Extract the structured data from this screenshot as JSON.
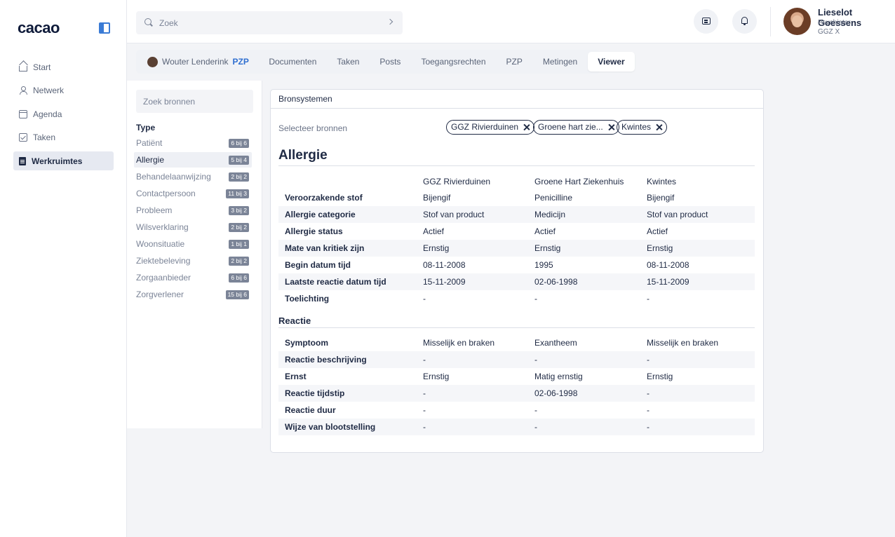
{
  "app": {
    "logo": "cacao"
  },
  "nav": [
    {
      "label": "Start",
      "icon": "home-icon",
      "active": false
    },
    {
      "label": "Netwerk",
      "icon": "user-icon",
      "active": false
    },
    {
      "label": "Agenda",
      "icon": "calendar-icon",
      "active": false
    },
    {
      "label": "Taken",
      "icon": "checkbox-icon",
      "active": false
    },
    {
      "label": "Werkruimtes",
      "icon": "document-icon",
      "active": true
    }
  ],
  "search": {
    "placeholder": "Zoek"
  },
  "user": {
    "name": "Lieselot Goessens",
    "role": "Psychiater",
    "org": "GGZ X"
  },
  "tabs": {
    "patient_name": "Wouter Lenderink",
    "patient_tag": "PZP",
    "items": [
      "Documenten",
      "Taken",
      "Posts",
      "Toegangsrechten",
      "PZP",
      "Metingen",
      "Viewer"
    ],
    "active": "Viewer"
  },
  "filter": {
    "search_placeholder": "Zoek bronnen",
    "type_heading": "Type",
    "types": [
      {
        "label": "Patiënt",
        "badge": "6 bij 6",
        "active": false
      },
      {
        "label": "Allergie",
        "badge": "5 bij 4",
        "active": true
      },
      {
        "label": "Behandelaanwijzing",
        "badge": "2 bij 2",
        "active": false
      },
      {
        "label": "Contactpersoon",
        "badge": "11 bij 3",
        "active": false
      },
      {
        "label": "Probleem",
        "badge": "3 bij 2",
        "active": false
      },
      {
        "label": "Wilsverklaring",
        "badge": "2 bij 2",
        "active": false
      },
      {
        "label": "Woonsituatie",
        "badge": "1 bij 1",
        "active": false
      },
      {
        "label": "Ziektebeleving",
        "badge": "2 bij 2",
        "active": false
      },
      {
        "label": "Zorgaanbieder",
        "badge": "6 bij 6",
        "active": false
      },
      {
        "label": "Zorgverlener",
        "badge": "15 bij 6",
        "active": false
      }
    ]
  },
  "viewer": {
    "card_title": "Bronsystemen",
    "select_label": "Selecteer bronnen",
    "chips": [
      "GGZ Rivierduinen",
      "Groene hart zie...",
      "Kwintes"
    ],
    "section_title": "Allergie",
    "columns": [
      "GGZ Rivierduinen",
      "Groene Hart Ziekenhuis",
      "Kwintes"
    ],
    "allergy_rows": [
      {
        "label": "Veroorzakende stof",
        "values": [
          "Bijengif",
          "Penicilline",
          "Bijengif"
        ]
      },
      {
        "label": "Allergie categorie",
        "values": [
          "Stof van product",
          "Medicijn",
          "Stof van product"
        ]
      },
      {
        "label": "Allergie status",
        "values": [
          "Actief",
          "Actief",
          "Actief"
        ]
      },
      {
        "label": "Mate van kritiek zijn",
        "values": [
          "Ernstig",
          "Ernstig",
          "Ernstig"
        ]
      },
      {
        "label": "Begin datum tijd",
        "values": [
          "08-11-2008",
          "1995",
          "08-11-2008"
        ]
      },
      {
        "label": "Laatste reactie datum tijd",
        "values": [
          "15-11-2009",
          "02-06-1998",
          "15-11-2009"
        ]
      },
      {
        "label": "Toelichting",
        "values": [
          "-",
          "-",
          "-"
        ]
      }
    ],
    "reaction_title": "Reactie",
    "reaction_rows": [
      {
        "label": "Symptoom",
        "values": [
          "Misselijk en braken",
          "Exantheem",
          "Misselijk en braken"
        ]
      },
      {
        "label": "Reactie beschrijving",
        "values": [
          "-",
          "-",
          "-"
        ]
      },
      {
        "label": "Ernst",
        "values": [
          "Ernstig",
          "Matig ernstig",
          "Ernstig"
        ]
      },
      {
        "label": "Reactie tijdstip",
        "values": [
          "-",
          "02-06-1998",
          "-"
        ]
      },
      {
        "label": "Reactie duur",
        "values": [
          "-",
          "-",
          "-"
        ]
      },
      {
        "label": "Wijze van blootstelling",
        "values": [
          "-",
          "-",
          "-"
        ]
      }
    ]
  }
}
